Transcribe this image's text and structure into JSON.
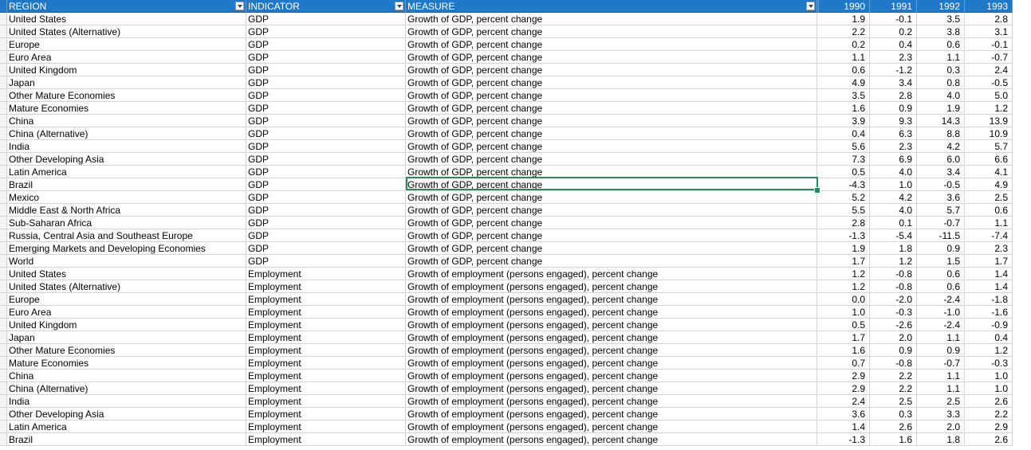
{
  "columns": {
    "region": "REGION",
    "indicator": "INDICATOR",
    "measure": "MEASURE",
    "years": [
      "1990",
      "1991",
      "1992",
      "1993"
    ]
  },
  "row_markers": [
    "",
    "",
    "",
    "",
    "",
    "",
    "",
    "",
    "",
    "",
    "",
    "",
    "",
    "",
    "",
    "",
    "",
    "",
    "",
    "",
    "",
    "",
    "",
    "",
    "",
    "",
    "",
    "",
    "",
    "",
    "",
    "",
    "",
    "",
    "",
    ""
  ],
  "rows": [
    {
      "region": "United States",
      "indicator": "GDP",
      "measure": "Growth of GDP, percent change",
      "values": [
        "1.9",
        "-0.1",
        "3.5",
        "2.8"
      ]
    },
    {
      "region": "United States (Alternative)",
      "indicator": "GDP",
      "measure": "Growth of GDP, percent change",
      "values": [
        "2.2",
        "0.2",
        "3.8",
        "3.1"
      ]
    },
    {
      "region": "Europe",
      "indicator": "GDP",
      "measure": "Growth of GDP, percent change",
      "values": [
        "0.2",
        "0.4",
        "0.6",
        "-0.1"
      ]
    },
    {
      "region": "Euro Area",
      "indicator": "GDP",
      "measure": "Growth of GDP, percent change",
      "values": [
        "1.1",
        "2.3",
        "1.1",
        "-0.7"
      ]
    },
    {
      "region": "United Kingdom",
      "indicator": "GDP",
      "measure": "Growth of GDP, percent change",
      "values": [
        "0.6",
        "-1.2",
        "0.3",
        "2.4"
      ]
    },
    {
      "region": "Japan",
      "indicator": "GDP",
      "measure": "Growth of GDP, percent change",
      "values": [
        "4.9",
        "3.4",
        "0.8",
        "-0.5"
      ]
    },
    {
      "region": "Other Mature Economies",
      "indicator": "GDP",
      "measure": "Growth of GDP, percent change",
      "values": [
        "3.5",
        "2.8",
        "4.0",
        "5.0"
      ]
    },
    {
      "region": "Mature Economies",
      "indicator": "GDP",
      "measure": "Growth of GDP, percent change",
      "values": [
        "1.6",
        "0.9",
        "1.9",
        "1.2"
      ]
    },
    {
      "region": "China",
      "indicator": "GDP",
      "measure": "Growth of GDP, percent change",
      "values": [
        "3.9",
        "9.3",
        "14.3",
        "13.9"
      ]
    },
    {
      "region": "China (Alternative)",
      "indicator": "GDP",
      "measure": "Growth of GDP, percent change",
      "values": [
        "0.4",
        "6.3",
        "8.8",
        "10.9"
      ]
    },
    {
      "region": "India",
      "indicator": "GDP",
      "measure": "Growth of GDP, percent change",
      "values": [
        "5.6",
        "2.3",
        "4.2",
        "5.7"
      ]
    },
    {
      "region": "Other Developing Asia",
      "indicator": "GDP",
      "measure": "Growth of GDP, percent change",
      "values": [
        "7.3",
        "6.9",
        "6.0",
        "6.6"
      ]
    },
    {
      "region": "Latin America",
      "indicator": "GDP",
      "measure": "Growth of GDP, percent change",
      "values": [
        "0.5",
        "4.0",
        "3.4",
        "4.1"
      ]
    },
    {
      "region": "Brazil",
      "indicator": "GDP",
      "measure": "Growth of GDP, percent change",
      "values": [
        "-4.3",
        "1.0",
        "-0.5",
        "4.9"
      ]
    },
    {
      "region": "Mexico",
      "indicator": "GDP",
      "measure": "Growth of GDP, percent change",
      "values": [
        "5.2",
        "4.2",
        "3.6",
        "2.5"
      ]
    },
    {
      "region": "Middle East & North Africa",
      "indicator": "GDP",
      "measure": "Growth of GDP, percent change",
      "values": [
        "5.5",
        "4.0",
        "5.7",
        "0.6"
      ]
    },
    {
      "region": "Sub-Saharan Africa",
      "indicator": "GDP",
      "measure": "Growth of GDP, percent change",
      "values": [
        "2.8",
        "0.1",
        "-0.7",
        "1.1"
      ]
    },
    {
      "region": "Russia, Central Asia and Southeast Europe",
      "indicator": "GDP",
      "measure": "Growth of GDP, percent change",
      "values": [
        "-1.3",
        "-5.4",
        "-11.5",
        "-7.4"
      ]
    },
    {
      "region": "Emerging Markets and Developing Economies",
      "indicator": "GDP",
      "measure": "Growth of GDP, percent change",
      "values": [
        "1.9",
        "1.8",
        "0.9",
        "2.3"
      ]
    },
    {
      "region": "World",
      "indicator": "GDP",
      "measure": "Growth of GDP, percent change",
      "values": [
        "1.7",
        "1.2",
        "1.5",
        "1.7"
      ]
    },
    {
      "region": "United States",
      "indicator": "Employment",
      "measure": "Growth of employment (persons engaged), percent change",
      "values": [
        "1.2",
        "-0.8",
        "0.6",
        "1.4"
      ]
    },
    {
      "region": "United States (Alternative)",
      "indicator": "Employment",
      "measure": "Growth of employment (persons engaged), percent change",
      "values": [
        "1.2",
        "-0.8",
        "0.6",
        "1.4"
      ]
    },
    {
      "region": "Europe",
      "indicator": "Employment",
      "measure": "Growth of employment (persons engaged), percent change",
      "values": [
        "0.0",
        "-2.0",
        "-2.4",
        "-1.8"
      ]
    },
    {
      "region": "Euro Area",
      "indicator": "Employment",
      "measure": "Growth of employment (persons engaged), percent change",
      "values": [
        "1.0",
        "-0.3",
        "-1.0",
        "-1.6"
      ]
    },
    {
      "region": "United Kingdom",
      "indicator": "Employment",
      "measure": "Growth of employment (persons engaged), percent change",
      "values": [
        "0.5",
        "-2.6",
        "-2.4",
        "-0.9"
      ]
    },
    {
      "region": "Japan",
      "indicator": "Employment",
      "measure": "Growth of employment (persons engaged), percent change",
      "values": [
        "1.7",
        "2.0",
        "1.1",
        "0.4"
      ]
    },
    {
      "region": "Other Mature Economies",
      "indicator": "Employment",
      "measure": "Growth of employment (persons engaged), percent change",
      "values": [
        "1.6",
        "0.9",
        "0.9",
        "1.2"
      ]
    },
    {
      "region": "Mature Economies",
      "indicator": "Employment",
      "measure": "Growth of employment (persons engaged), percent change",
      "values": [
        "0.7",
        "-0.8",
        "-0.7",
        "-0.3"
      ]
    },
    {
      "region": "China",
      "indicator": "Employment",
      "measure": "Growth of employment (persons engaged), percent change",
      "values": [
        "2.9",
        "2.2",
        "1.1",
        "1.0"
      ]
    },
    {
      "region": "China (Alternative)",
      "indicator": "Employment",
      "measure": "Growth of employment (persons engaged), percent change",
      "values": [
        "2.9",
        "2.2",
        "1.1",
        "1.0"
      ]
    },
    {
      "region": "India",
      "indicator": "Employment",
      "measure": "Growth of employment (persons engaged), percent change",
      "values": [
        "2.4",
        "2.5",
        "2.5",
        "2.6"
      ]
    },
    {
      "region": "Other Developing Asia",
      "indicator": "Employment",
      "measure": "Growth of employment (persons engaged), percent change",
      "values": [
        "3.6",
        "0.3",
        "3.3",
        "2.2"
      ]
    },
    {
      "region": "Latin America",
      "indicator": "Employment",
      "measure": "Growth of employment (persons engaged), percent change",
      "values": [
        "1.4",
        "2.6",
        "2.0",
        "2.9"
      ]
    },
    {
      "region": "Brazil",
      "indicator": "Employment",
      "measure": "Growth of employment (persons engaged), percent change",
      "values": [
        "-1.3",
        "1.6",
        "1.8",
        "2.6"
      ]
    }
  ],
  "selected_cell": {
    "row_index": 13,
    "column": "measure"
  },
  "colors": {
    "header_bg": "#1f78c8",
    "selection": "#1e8f5a"
  }
}
